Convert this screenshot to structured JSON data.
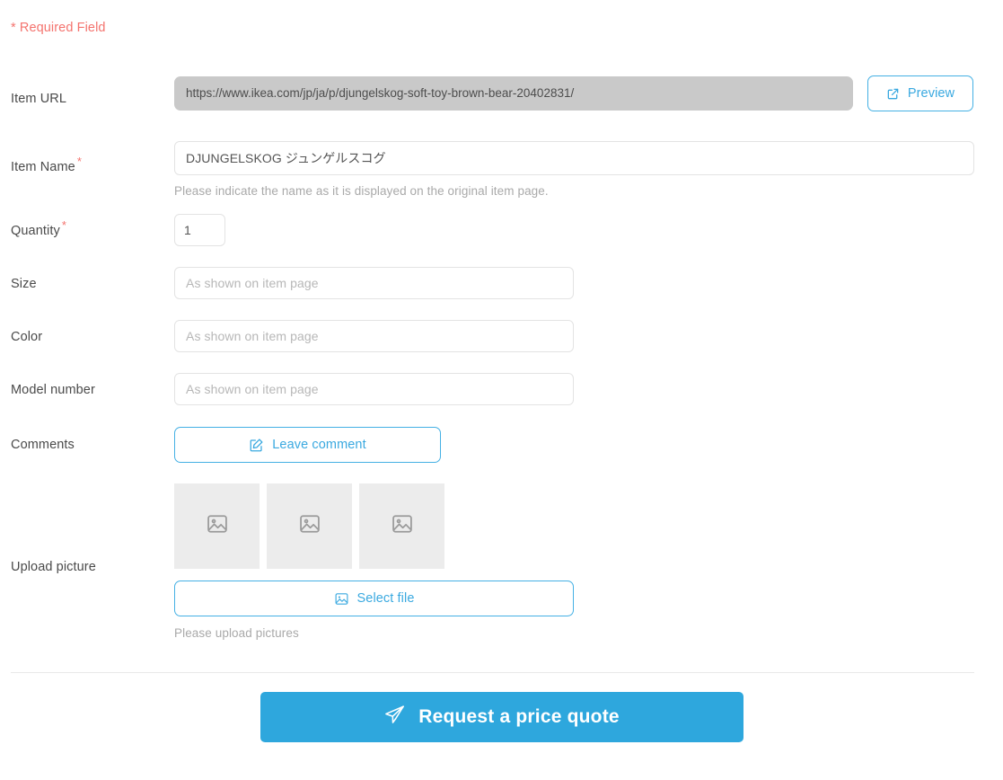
{
  "form": {
    "required_note": "* Required Field",
    "rows": {
      "item_url": {
        "label": "Item URL",
        "value": "https://www.ikea.com/jp/ja/p/djungelskog-soft-toy-brown-bear-20402831/",
        "preview_label": "Preview"
      },
      "item_name": {
        "label": "Item Name",
        "required_mark": "*",
        "value": "DJUNGELSKOG ジュンゲルスコグ",
        "helper": "Please indicate the name as it is displayed on the original item page."
      },
      "quantity": {
        "label": "Quantity",
        "required_mark": "*",
        "value": "1"
      },
      "size": {
        "label": "Size",
        "placeholder": "As shown on item page",
        "value": ""
      },
      "color": {
        "label": "Color",
        "placeholder": "As shown on item page",
        "value": ""
      },
      "model_number": {
        "label": "Model number",
        "placeholder": "As shown on item page",
        "value": ""
      },
      "comments": {
        "label": "Comments",
        "button_label": "Leave comment"
      },
      "upload_picture": {
        "label": "Upload picture",
        "select_file_label": "Select file",
        "helper": "Please upload pictures",
        "thumbnail_count": 3
      }
    },
    "submit": {
      "label": "Request a price quote"
    }
  },
  "colors": {
    "accent_blue": "#2ea7dd",
    "outline_blue": "#44b0e4",
    "required_red": "#f4736e",
    "disabled_gray": "#c9c9c9",
    "thumb_gray": "#ececec",
    "label_gray": "#4a4a4a",
    "helper_gray": "#a9a9a9"
  },
  "icons": {
    "preview": "external-link-icon",
    "comment": "pencil-square-icon",
    "select_file": "image-icon",
    "thumbnail": "image-placeholder-icon",
    "submit": "paper-plane-icon"
  }
}
